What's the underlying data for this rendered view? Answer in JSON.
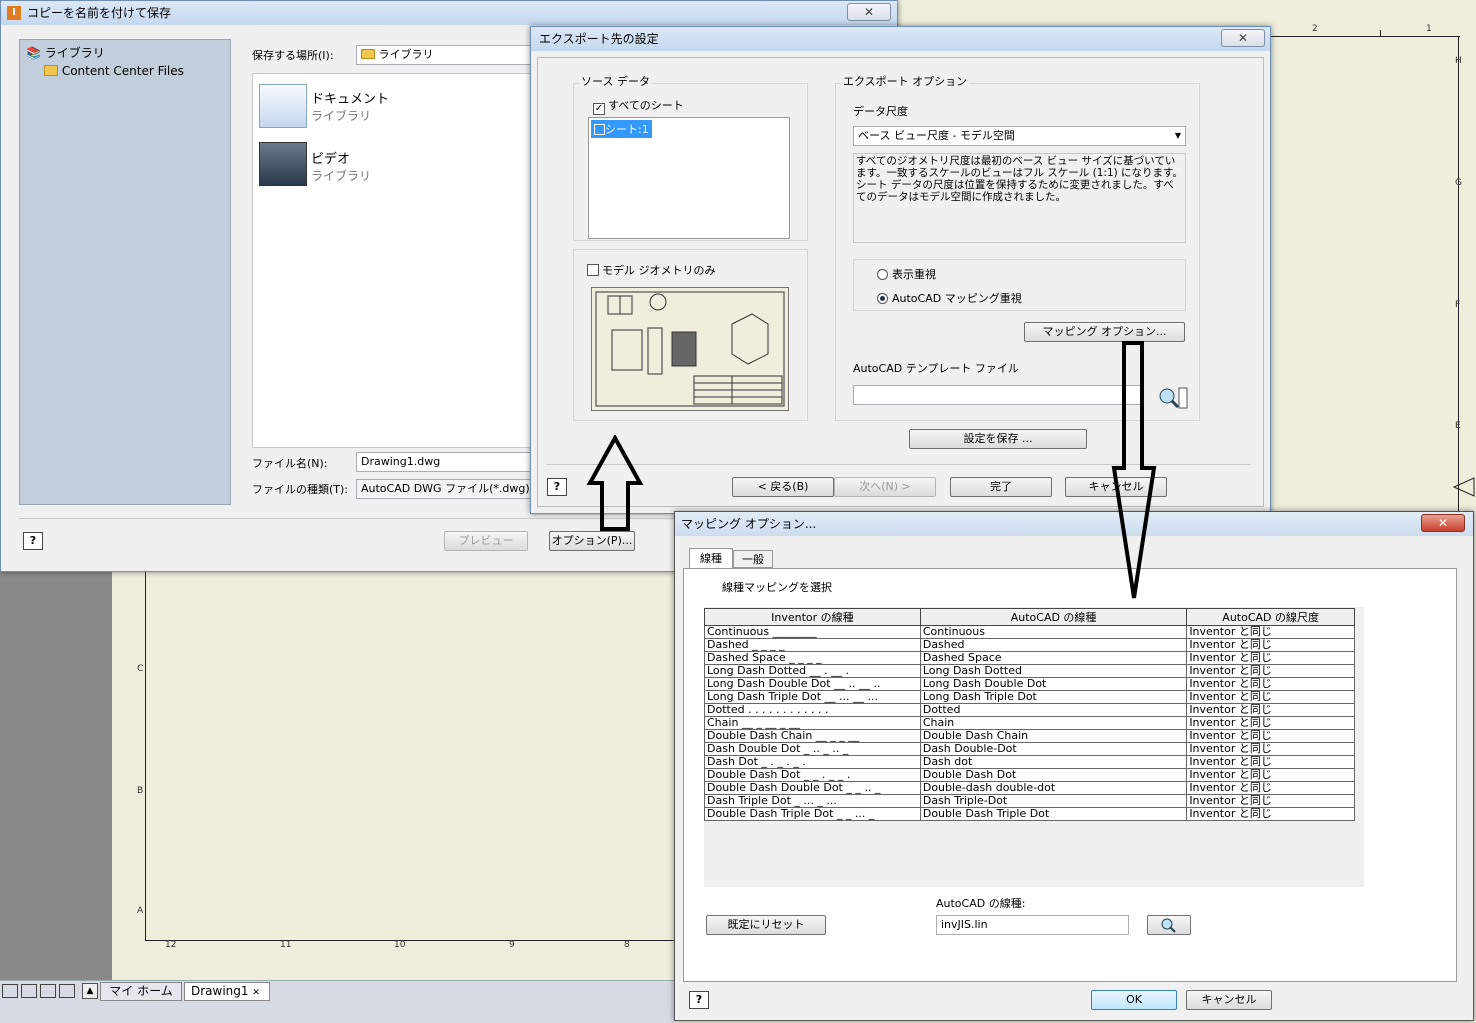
{
  "background": {
    "top_ruler": [
      "2",
      "1"
    ],
    "right_ruler": [
      "H",
      "G",
      "F",
      "E"
    ],
    "left_ruler": [
      "C",
      "B",
      "A"
    ],
    "bottom_ruler": [
      "12",
      "11",
      "10",
      "9",
      "8"
    ]
  },
  "taskbar": {
    "tabs": [
      {
        "label": "マイ ホーム"
      },
      {
        "label": "Drawing1"
      }
    ]
  },
  "save_dialog": {
    "title": "コピーを名前を付けて保存",
    "close": "✕",
    "tree": {
      "root": "ライブラリ",
      "child": "Content Center Files"
    },
    "save_in_label": "保存する場所(I):",
    "save_in_value": "ライブラリ",
    "items": [
      {
        "name": "ドキュメント",
        "sub": "ライブラリ"
      },
      {
        "name": "ビデオ",
        "sub": "ライブラリ"
      }
    ],
    "filename_label": "ファイル名(N):",
    "filename_value": "Drawing1.dwg",
    "filetype_label": "ファイルの種類(T):",
    "filetype_value": "AutoCAD DWG ファイル(*.dwg)",
    "help": "?",
    "preview_btn": "プレビュー",
    "options_btn": "オプション(P)..."
  },
  "export_dialog": {
    "title": "エクスポート先の設定",
    "close": "✕",
    "source_group": "ソース データ",
    "all_sheets": "すべてのシート",
    "sheet_item": "シート:1",
    "model_only": "モデル ジオメトリのみ",
    "export_group": "エクスポート オプション",
    "data_scale_label": "データ尺度",
    "data_scale_value": "ベース ビュー尺度 - モデル空間",
    "description": "すべてのジオメトリ尺度は最初のベース ビュー サイズに基づいています。一致するスケールのビューはフル スケール (1:1) になります。シート データの尺度は位置を保持するために変更されました。すべてのデータはモデル空間に作成されました。",
    "radio_display": "表示重視",
    "radio_mapping": "AutoCAD マッピング重視",
    "mapping_btn": "マッピング オプション...",
    "template_label": "AutoCAD テンプレート ファイル",
    "template_value": "",
    "save_settings_btn": "設定を保存 ...",
    "help": "?",
    "back_btn": "< 戻る(B)",
    "next_btn": "次へ(N) >",
    "finish_btn": "完了",
    "cancel_btn": "キャンセル"
  },
  "mapping_dialog": {
    "title": "マッピング オプション...",
    "close": "✕",
    "tabs": [
      "線種",
      "一般"
    ],
    "section_label": "線種マッピングを選択",
    "columns": [
      "Inventor の線種",
      "AutoCAD の線種",
      "AutoCAD の線尺度"
    ],
    "rows": [
      [
        "Continuous  ________",
        "Continuous",
        "Inventor と同じ"
      ],
      [
        "Dashed  _ _ _ _",
        "Dashed",
        "Inventor と同じ"
      ],
      [
        "Dashed Space  _  _  _  _",
        "Dashed Space",
        "Inventor と同じ"
      ],
      [
        "Long Dash Dotted  __ . __ .",
        "Long Dash Dotted",
        "Inventor と同じ"
      ],
      [
        "Long Dash Double  Dot  __ .. __ ..",
        "Long Dash Double Dot",
        "Inventor と同じ"
      ],
      [
        "Long Dash Triple Dot  __ ... __ ...",
        "Long Dash Triple Dot",
        "Inventor と同じ"
      ],
      [
        "Dotted  . . . . . . . . . . . .",
        "Dotted",
        "Inventor と同じ"
      ],
      [
        "Chain  __ _ __ _ __",
        "Chain",
        "Inventor と同じ"
      ],
      [
        "Double Dash Chain  __ _ _ __",
        "Double Dash Chain",
        "Inventor と同じ"
      ],
      [
        "Dash Double Dot  _ .. _ .. _",
        "Dash Double-Dot",
        "Inventor と同じ"
      ],
      [
        "Dash Dot  _ . _ . _ .",
        "Dash dot",
        "Inventor と同じ"
      ],
      [
        "Double Dash Dot  _ _ . _ _ .",
        "Double Dash Dot",
        "Inventor と同じ"
      ],
      [
        "Double Dash Double Dot  _ _ .. _",
        "Double-dash double-dot",
        "Inventor と同じ"
      ],
      [
        "Dash Triple Dot  _ ... _ ...",
        "Dash Triple-Dot",
        "Inventor と同じ"
      ],
      [
        "Double Dash Triple Dot  _ _ ... _",
        "Double Dash Triple Dot",
        "Inventor と同じ"
      ]
    ],
    "reset_btn": "既定にリセット",
    "autocad_lt_label": "AutoCAD の線種:",
    "autocad_lt_value": "invJIS.lin",
    "help": "?",
    "ok_btn": "OK",
    "cancel_btn": "キャンセル"
  }
}
